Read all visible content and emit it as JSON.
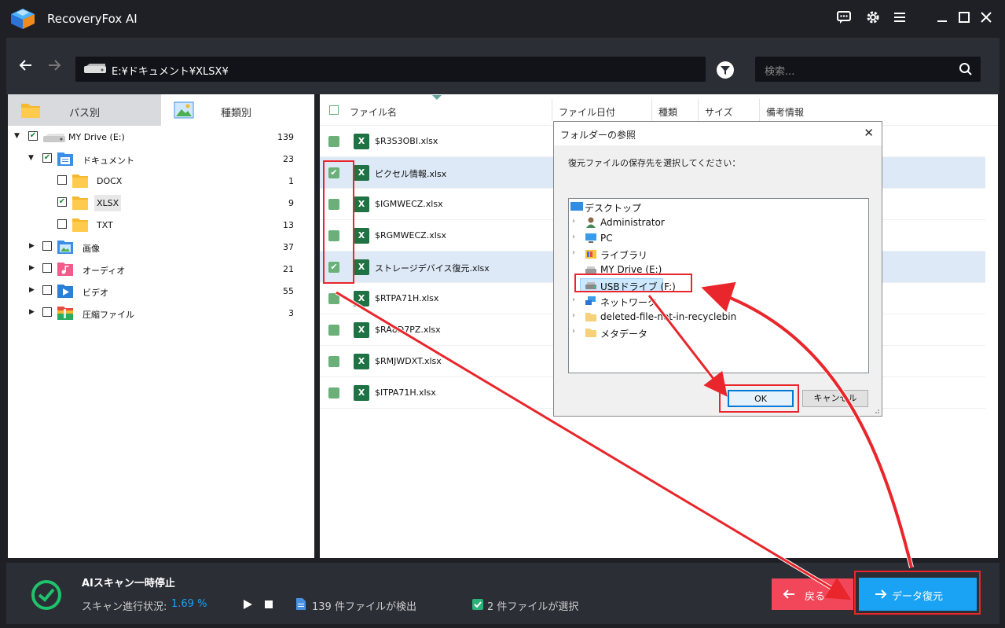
{
  "app": {
    "title": "RecoveryFox AI"
  },
  "navbar": {
    "path": "E:¥ドキュメント¥XLSX¥",
    "search_placeholder": "検索..."
  },
  "left_panel": {
    "tabs": [
      {
        "label": "パス別"
      },
      {
        "label": "種類別"
      }
    ],
    "tree": [
      {
        "label": "MY Drive (E:)",
        "count": "139"
      },
      {
        "label": "ドキュメント",
        "count": "23"
      },
      {
        "label": "DOCX",
        "count": "1"
      },
      {
        "label": "XLSX",
        "count": "9"
      },
      {
        "label": "TXT",
        "count": "13"
      },
      {
        "label": "画像",
        "count": "37"
      },
      {
        "label": "オーディオ",
        "count": "21"
      },
      {
        "label": "ビデオ",
        "count": "55"
      },
      {
        "label": "圧縮ファイル",
        "count": "3"
      }
    ]
  },
  "file_list": {
    "columns": [
      "ファイル名",
      "ファイル日付",
      "種類",
      "サイズ",
      "備考情報"
    ],
    "rows": [
      {
        "name": "$R3S3OBI.xlsx"
      },
      {
        "name": "ピクセル情報.xlsx"
      },
      {
        "name": "$IGMWECZ.xlsx"
      },
      {
        "name": "$RGMWECZ.xlsx"
      },
      {
        "name": "ストレージデバイス復元.xlsx"
      },
      {
        "name": "$RTPA71H.xlsx"
      },
      {
        "name": "$RA8D7PZ.xlsx"
      },
      {
        "name": "$RMJWDXT.xlsx"
      },
      {
        "name": "$ITPA71H.xlsx"
      }
    ],
    "xls_icon_letter": "X"
  },
  "dialog": {
    "title": "フォルダーの参照",
    "instruction": "復元ファイルの保存先を選択してください：",
    "tree": [
      {
        "label": "デスクトップ"
      },
      {
        "label": "Administrator"
      },
      {
        "label": "PC"
      },
      {
        "label": "ライブラリ"
      },
      {
        "label": "MY Drive (E:)"
      },
      {
        "label": "USBドライブ (F:)"
      },
      {
        "label": "ネットワーク"
      },
      {
        "label": "deleted-file-not-in-recyclebin"
      },
      {
        "label": "メタデータ"
      }
    ],
    "ok_label": "OK",
    "cancel_label": "キャンセル"
  },
  "bottom": {
    "status_title": "AIスキャン一時停止",
    "progress_label": "スキャン進行状況:",
    "progress_value": "1.69 %",
    "found_text": "139 件ファイルが検出",
    "selected_text": "2 件ファイルが選択",
    "back_label": "戻る",
    "recover_label": "データ復元"
  },
  "colors": {
    "accent_blue": "#1aa3f5",
    "back_red": "#f2465a",
    "annotation_red": "#e8262b",
    "status_green": "#1fc36c"
  }
}
